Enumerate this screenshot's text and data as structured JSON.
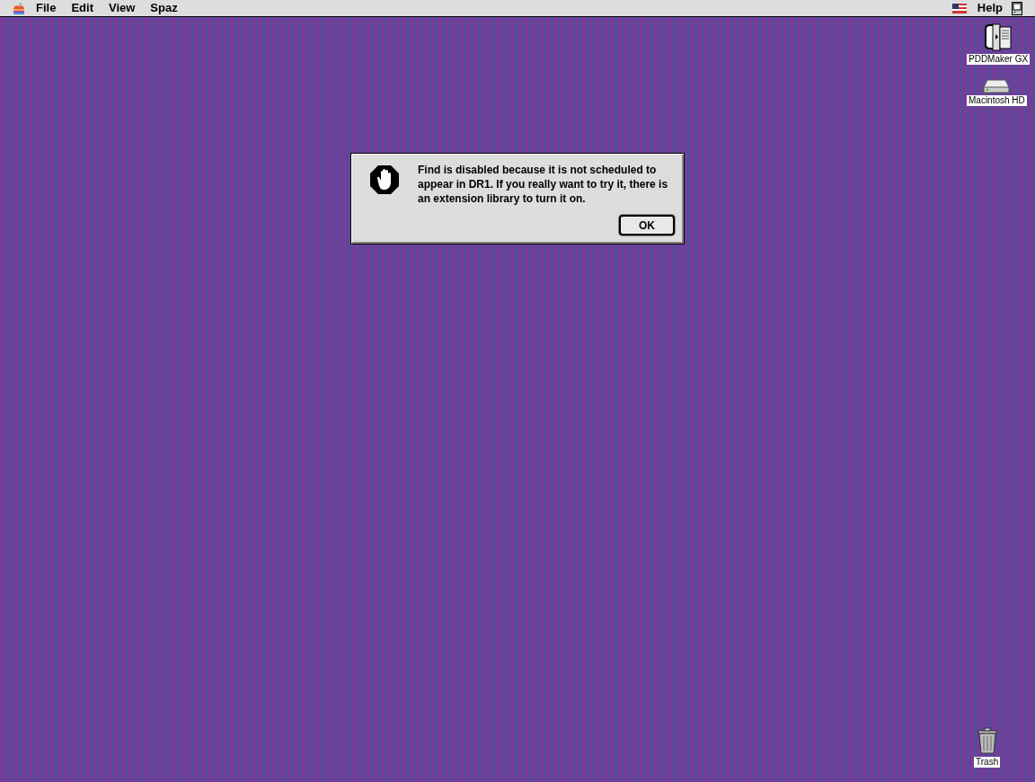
{
  "menu_bar": {
    "menus": [
      "File",
      "Edit",
      "View",
      "Spaz"
    ],
    "right": [
      "Help"
    ]
  },
  "desktop_icons": [
    {
      "kind": "app",
      "label": "PDDMaker GX"
    },
    {
      "kind": "disk",
      "label": "Macintosh HD"
    },
    {
      "kind": "trash",
      "label": "Trash"
    }
  ],
  "alert": {
    "message": "Find is disabled because it is not scheduled to appear in DR1. If you really want to try it, there is an extension library to turn it on.",
    "buttons": [
      "OK"
    ]
  }
}
